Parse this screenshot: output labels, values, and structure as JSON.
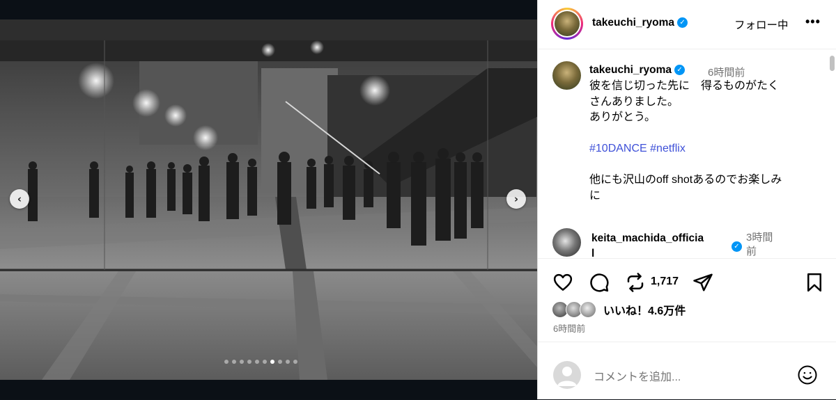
{
  "carousel": {
    "prev_glyph": "‹",
    "next_glyph": "›",
    "dots_total": 10,
    "active_dot_index": 6
  },
  "post_header": {
    "username": "takeuchi_ryoma",
    "verified": true,
    "follow_label": "フォロー中",
    "more_label": "•••"
  },
  "caption": {
    "username": "takeuchi_ryoma",
    "time": "6時間前",
    "line1": "彼を信じ切った先に　得るものがたく",
    "line2": "さんありました。",
    "line3": "ありがとう。",
    "hashtags": "#10DANCE #netflix",
    "line4": "他にも沢山のoff shotあるのでお楽しみ",
    "line5": "に"
  },
  "comments": [
    {
      "username": "keita_machida_officia",
      "username_tail": "l",
      "time_line1": "3時間",
      "time_line2": "前"
    }
  ],
  "actions": {
    "repost_count": "1,717",
    "likes_text": "いいね！4.6万件",
    "posted_time": "6時間前",
    "icons": [
      "heart-icon",
      "comment-icon",
      "repost-icon",
      "share-icon",
      "bookmark-icon"
    ]
  },
  "comment_input": {
    "placeholder": "コメントを追加..."
  },
  "colors": {
    "link": "#3f51d8",
    "verified": "#0095f6",
    "muted": "#737373",
    "media_bg": "#0b1016"
  }
}
